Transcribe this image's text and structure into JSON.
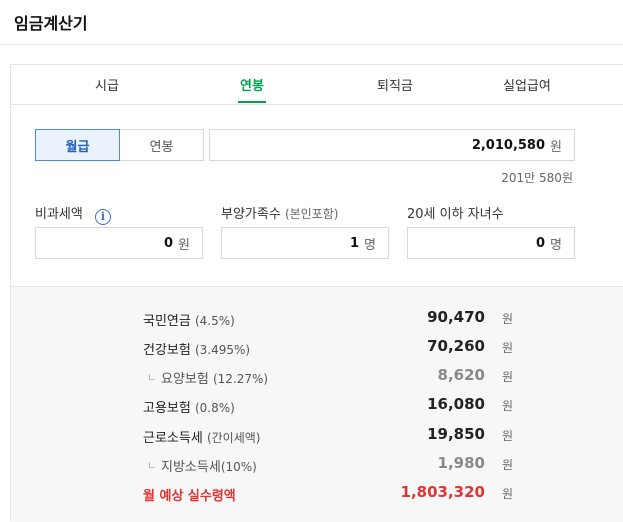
{
  "app": {
    "title": "임금계산기"
  },
  "tabs": [
    {
      "label": "시급"
    },
    {
      "label": "연봉"
    },
    {
      "label": "퇴직금"
    },
    {
      "label": "실업급여"
    }
  ],
  "active_tab": "연봉",
  "pay_type": {
    "options": [
      {
        "label": "월급"
      },
      {
        "label": "연봉"
      }
    ],
    "selected": "월급"
  },
  "amount": {
    "value": "2,010,580",
    "unit": "원",
    "hint": "201만 580원"
  },
  "fields": {
    "tax_free": {
      "label": "비과세액",
      "value": "0",
      "unit": "원"
    },
    "dependents": {
      "label": "부양가족수",
      "sub": "(본인포함)",
      "value": "1",
      "unit": "명"
    },
    "children": {
      "label": "20세 이하 자녀수",
      "value": "0",
      "unit": "명"
    }
  },
  "results": {
    "national_pension": {
      "label": "국민연금",
      "rate": "(4.5%)",
      "value": "90,470",
      "unit": "원"
    },
    "health_insurance": {
      "label": "건강보험",
      "rate": "(3.495%)",
      "value": "70,260",
      "unit": "원"
    },
    "long_term_care": {
      "label": "요양보험",
      "rate": "(12.27%)",
      "value": "8,620",
      "unit": "원"
    },
    "employment_insurance": {
      "label": "고용보험",
      "rate": "(0.8%)",
      "value": "16,080",
      "unit": "원"
    },
    "income_tax": {
      "label": "근로소득세",
      "rate": "(간이세액)",
      "value": "19,850",
      "unit": "원"
    },
    "local_income_tax": {
      "label": "지방소득세",
      "rate": "(10%)",
      "value": "1,980",
      "unit": "원"
    },
    "net_pay": {
      "label": "월 예상 실수령액",
      "value": "1,803,320",
      "unit": "원"
    }
  },
  "colors": {
    "accent_green": "#03a34f",
    "selected_blue": "#4a8ae0",
    "total_red": "#e03535"
  },
  "icons": {
    "info": "info-icon"
  }
}
